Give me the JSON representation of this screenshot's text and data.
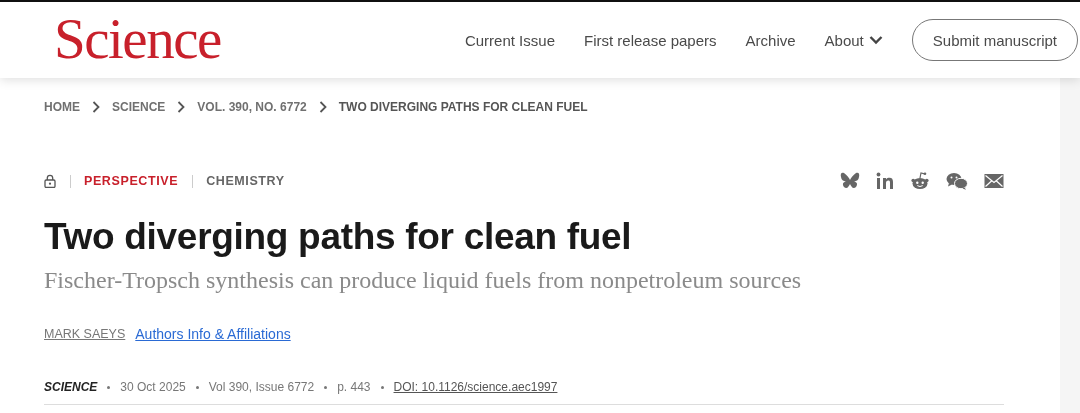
{
  "header": {
    "logo": "Science",
    "nav": [
      {
        "label": "Current Issue",
        "has_menu": false
      },
      {
        "label": "First release papers",
        "has_menu": false
      },
      {
        "label": "Archive",
        "has_menu": false
      },
      {
        "label": "About",
        "has_menu": true
      }
    ],
    "submit_button": "Submit manuscript"
  },
  "breadcrumb": [
    {
      "label": "HOME",
      "current": false
    },
    {
      "label": "SCIENCE",
      "current": false
    },
    {
      "label": "VOL. 390, NO. 6772",
      "current": false
    },
    {
      "label": "TWO DIVERGING PATHS FOR CLEAN FUEL",
      "current": true
    }
  ],
  "article": {
    "locked": true,
    "type": "PERSPECTIVE",
    "subject": "CHEMISTRY",
    "share": [
      {
        "kind": "bluesky"
      },
      {
        "kind": "linkedin"
      },
      {
        "kind": "reddit"
      },
      {
        "kind": "wechat"
      },
      {
        "kind": "email"
      }
    ],
    "title": "Two diverging paths for clean fuel",
    "subtitle": "Fischer-Tropsch synthesis can produce liquid fuels from nonpetroleum sources",
    "author": "MARK SAEYS",
    "authors_link": "Authors Info & Affiliations",
    "journal": "SCIENCE",
    "date": "30 Oct 2025",
    "volume": "Vol 390, Issue 6772",
    "page": "p. 443",
    "doi": "DOI: 10.1126/science.aec1997"
  }
}
